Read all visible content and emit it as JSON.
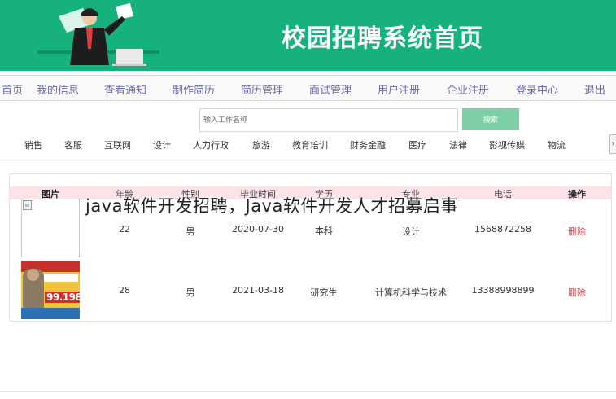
{
  "banner": {
    "title": "校园招聘系统首页",
    "accent": "#16b17f"
  },
  "nav": [
    {
      "label": "首页"
    },
    {
      "label": "我的信息"
    },
    {
      "label": "查看通知"
    },
    {
      "label": "制作简历"
    },
    {
      "label": "简历管理"
    },
    {
      "label": "面试管理"
    },
    {
      "label": "用户注册"
    },
    {
      "label": "企业注册"
    },
    {
      "label": "登录中心"
    },
    {
      "label": "退出"
    }
  ],
  "search": {
    "placeholder": "输入工作名称",
    "button": "搜索",
    "button_color": "#7ecfa6"
  },
  "categories": [
    "销售",
    "客服",
    "互联网",
    "设计",
    "人力行政",
    "旅游",
    "教育培训",
    "财务金融",
    "医疗",
    "法律",
    "影视传媒",
    "物流"
  ],
  "table": {
    "columns": [
      "图片",
      "年龄",
      "性别",
      "毕业时间",
      "学历",
      "专业",
      "电话",
      "操作"
    ],
    "rows": [
      {
        "photo": "broken-image",
        "age": "22",
        "gender": "男",
        "grad": "2020-07-30",
        "edu": "本科",
        "major": "设计",
        "phone": "1568872258",
        "action": "删除"
      },
      {
        "photo": "recruitment-poster",
        "poster_price": "99.198",
        "age": "28",
        "gender": "男",
        "grad": "2021-03-18",
        "edu": "研究生",
        "major": "计算机科学与技术",
        "phone": "13388998899",
        "action": "删除"
      }
    ]
  },
  "overlay_text": "java软件开发招聘，Java软件开发人才招募启事"
}
